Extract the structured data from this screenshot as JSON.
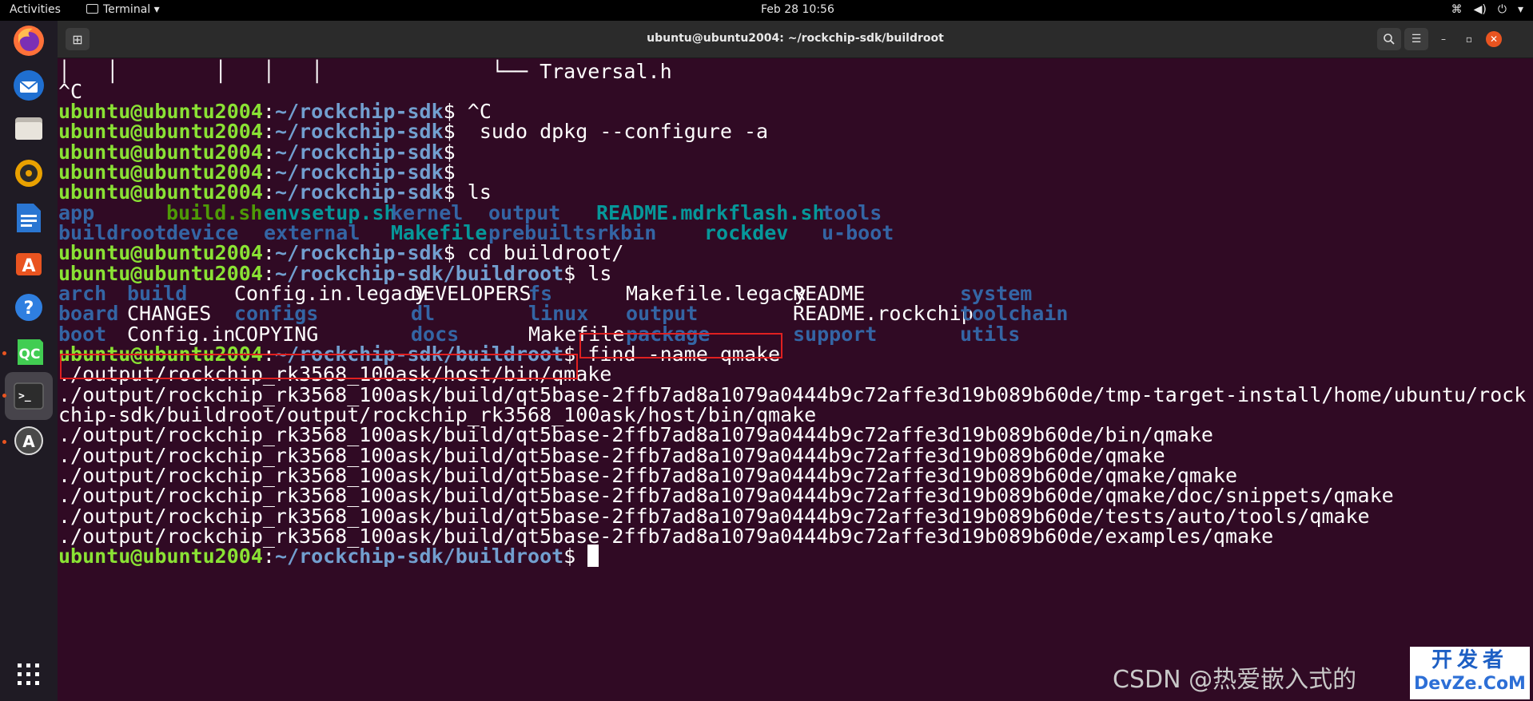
{
  "topbar": {
    "activities": "Activities",
    "app_menu": "Terminal",
    "clock": "Feb 28  10:56"
  },
  "window": {
    "title": "ubuntu@ubuntu2004: ~/rockchip-sdk/buildroot"
  },
  "terminal": {
    "prompt_user": "ubuntu@ubuntu2004",
    "tree_prefix": "│   │        │   │   │              └── ",
    "tree_file": "Traversal.h",
    "ctrl_c": "^C",
    "lines": [
      {
        "path": "~/rockchip-sdk",
        "cmd": " ^C"
      },
      {
        "path": "~/rockchip-sdk",
        "cmd": "  sudo dpkg --configure -a"
      },
      {
        "path": "~/rockchip-sdk",
        "cmd": ""
      },
      {
        "path": "~/rockchip-sdk",
        "cmd": ""
      },
      {
        "path": "~/rockchip-sdk",
        "cmd": " ls"
      }
    ],
    "ls_sdk": [
      [
        "app",
        "build.sh",
        "envsetup.sh",
        "kernel",
        "output",
        "README.md",
        "rkflash.sh",
        "tools"
      ],
      [
        "buildroot",
        "device",
        "external",
        "Makefile",
        "prebuilts",
        "rkbin",
        "rockdev",
        "u-boot"
      ]
    ],
    "cd_line": {
      "path": "~/rockchip-sdk",
      "cmd": " cd buildroot/"
    },
    "ls_line": {
      "path": "~/rockchip-sdk/buildroot",
      "cmd": " ls"
    },
    "ls_buildroot": [
      [
        "arch",
        "build",
        "Config.in.legacy",
        "DEVELOPERS",
        "fs",
        "Makefile.legacy",
        "README",
        "system"
      ],
      [
        "board",
        "CHANGES",
        "configs",
        "dl",
        "linux",
        "output",
        "README.rockchip",
        "toolchain"
      ],
      [
        "boot",
        "Config.in",
        "COPYING",
        "docs",
        "Makefile",
        "package",
        "support",
        "utils"
      ]
    ],
    "find_line": {
      "path": "~/rockchip-sdk/buildroot",
      "cmd": " find -name qmake"
    },
    "find_results": [
      "./output/rockchip_rk3568_100ask/host/bin/qmake",
      "./output/rockchip_rk3568_100ask/build/qt5base-2ffb7ad8a1079a0444b9c72affe3d19b089b60de/tmp-target-install/home/ubuntu/rock",
      "chip-sdk/buildroot/output/rockchip_rk3568_100ask/host/bin/qmake",
      "./output/rockchip_rk3568_100ask/build/qt5base-2ffb7ad8a1079a0444b9c72affe3d19b089b60de/bin/qmake",
      "./output/rockchip_rk3568_100ask/build/qt5base-2ffb7ad8a1079a0444b9c72affe3d19b089b60de/qmake",
      "./output/rockchip_rk3568_100ask/build/qt5base-2ffb7ad8a1079a0444b9c72affe3d19b089b60de/qmake/qmake",
      "./output/rockchip_rk3568_100ask/build/qt5base-2ffb7ad8a1079a0444b9c72affe3d19b089b60de/qmake/doc/snippets/qmake",
      "./output/rockchip_rk3568_100ask/build/qt5base-2ffb7ad8a1079a0444b9c72affe3d19b089b60de/tests/auto/tools/qmake",
      "./output/rockchip_rk3568_100ask/build/qt5base-2ffb7ad8a1079a0444b9c72affe3d19b089b60de/examples/qmake"
    ],
    "final_line": {
      "path": "~/rockchip-sdk/buildroot"
    }
  },
  "watermark": {
    "csdn": "CSDN @热爱嵌入式的",
    "site_cn": "开发者",
    "site_en": "DevZe.CoM"
  },
  "dock_icons": [
    "firefox-icon",
    "thunderbird-icon",
    "files-icon",
    "rhythmbox-icon",
    "writer-icon",
    "software-icon",
    "help-icon",
    "qtcreator-icon",
    "terminal-icon",
    "updater-icon",
    "app-grid-icon"
  ]
}
